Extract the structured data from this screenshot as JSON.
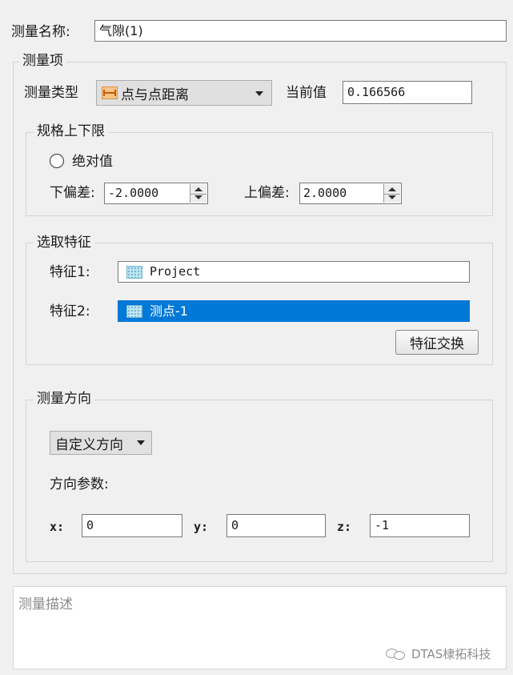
{
  "name_row": {
    "label": "测量名称:",
    "value": "气隙(1)"
  },
  "measure_item": {
    "title": "测量项",
    "type_label": "测量类型",
    "type_value": "点与点距离",
    "type_icon": "distance-icon",
    "current_label": "当前值",
    "current_value": "0.166566"
  },
  "tolerance": {
    "title": "规格上下限",
    "absolute_label": "绝对值",
    "absolute_checked": false,
    "lower_label": "下偏差:",
    "lower_value": "-2.0000",
    "upper_label": "上偏差:",
    "upper_value": "2.0000"
  },
  "features": {
    "title": "选取特征",
    "feature1_label": "特征1:",
    "feature1_value": "Project",
    "feature2_label": "特征2:",
    "feature2_value": "测点-1",
    "swap_button": "特征交换",
    "selected_color": "#0078d7"
  },
  "direction": {
    "title": "测量方向",
    "mode_value": "自定义方向",
    "params_label": "方向参数:",
    "x_label": "x:",
    "x_value": "0",
    "y_label": "y:",
    "y_value": "0",
    "z_label": "z:",
    "z_value": "-1"
  },
  "description": {
    "placeholder": "测量描述"
  },
  "watermark": {
    "text": "DTAS棣拓科技"
  }
}
